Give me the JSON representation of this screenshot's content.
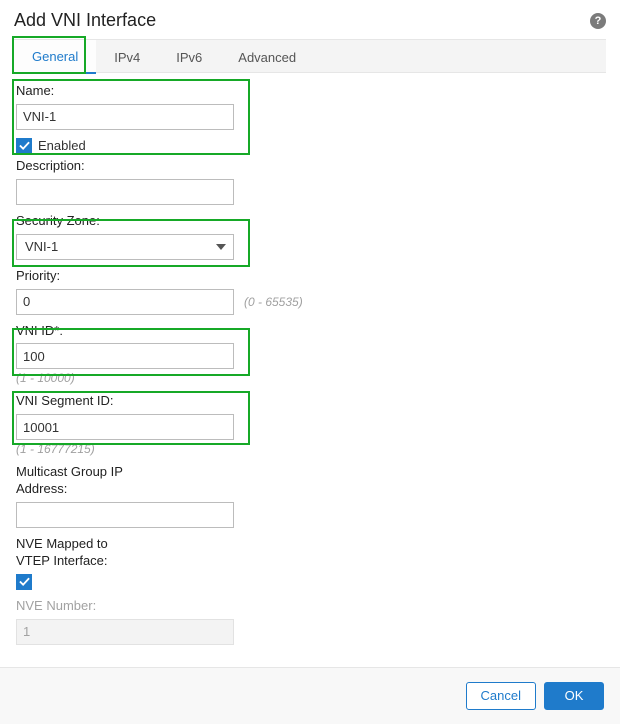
{
  "title": "Add VNI Interface",
  "tabs": [
    {
      "label": "General",
      "active": true
    },
    {
      "label": "IPv4",
      "active": false
    },
    {
      "label": "IPv6",
      "active": false
    },
    {
      "label": "Advanced",
      "active": false
    }
  ],
  "fields": {
    "name": {
      "label": "Name:",
      "value": "VNI-1"
    },
    "enabled": {
      "label": "Enabled",
      "checked": true
    },
    "description": {
      "label": "Description:",
      "value": ""
    },
    "security_zone": {
      "label": "Security Zone:",
      "value": "VNI-1"
    },
    "priority": {
      "label": "Priority:",
      "value": "0",
      "hint": "(0 - 65535)"
    },
    "vni_id": {
      "label": "VNI ID*:",
      "value": "100",
      "hint": "(1 - 10000)"
    },
    "vni_segment_id": {
      "label": "VNI Segment ID:",
      "value": "10001",
      "hint": "(1 - 16777215)"
    },
    "multicast_ip": {
      "label": "Multicast Group IP\nAddress:",
      "value": ""
    },
    "nve_mapped": {
      "label": "NVE Mapped to\nVTEP Interface:",
      "checked": true
    },
    "nve_number": {
      "label": "NVE Number:",
      "value": "1"
    }
  },
  "buttons": {
    "cancel": "Cancel",
    "ok": "OK"
  }
}
